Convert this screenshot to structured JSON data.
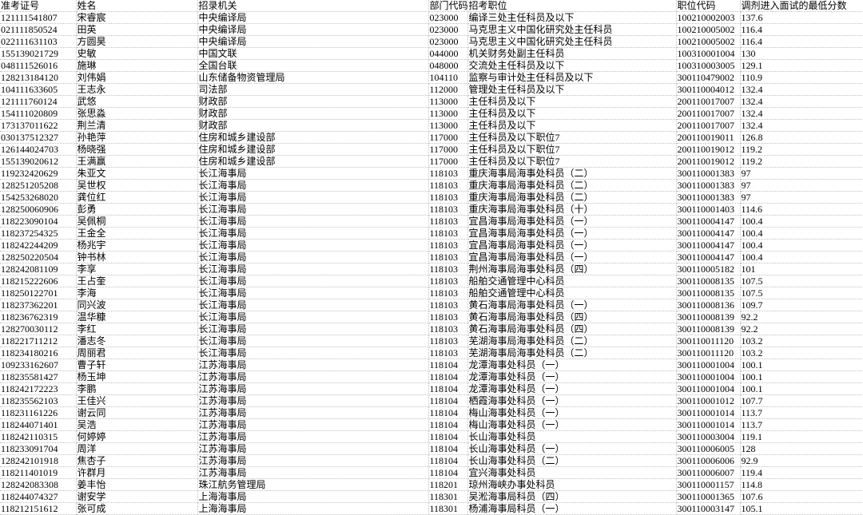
{
  "headers": [
    "准考证号",
    "姓名",
    "招录机关",
    "部门代码",
    "招考职位",
    "职位代码",
    "调剂进入面试的最低分数"
  ],
  "rows": [
    [
      "121111541807",
      "宋睿宸",
      "中央编译局",
      "023000",
      "编译三处主任科员及以下",
      "100210002003",
      "137.6"
    ],
    [
      "021111850524",
      "田英",
      "中央编译局",
      "023000",
      "马克思主义中国化研究处主任科员",
      "100210005002",
      "116.4"
    ],
    [
      "022111631103",
      "方圆昊",
      "中央编译局",
      "023000",
      "马克思主义中国化研究处主任科员",
      "100210005002",
      "116.4"
    ],
    [
      "155139021729",
      "史敏",
      "中国文联",
      "044000",
      "机关财务处副主任科员",
      "100310001004",
      "130"
    ],
    [
      "048111526016",
      "施琳",
      "全国台联",
      "048000",
      "交流处主任科员及以下",
      "100310003005",
      "129.1"
    ],
    [
      "128213184120",
      "刘伟娟",
      "山东储备物资管理局",
      "104110",
      "监察与审计处主任科员及以下",
      "300110479002",
      "110.9"
    ],
    [
      "104111633605",
      "王志永",
      "司法部",
      "112000",
      "管理处主任科员及以下",
      "300110004012",
      "132.4"
    ],
    [
      "121111760124",
      "武悠",
      "财政部",
      "113000",
      "主任科员及以下",
      "200110017007",
      "132.4"
    ],
    [
      "154111020809",
      "张思淼",
      "财政部",
      "113000",
      "主任科员及以下",
      "200110017007",
      "132.4"
    ],
    [
      "173137011622",
      "荆兰清",
      "财政部",
      "113000",
      "主任科员及以下",
      "200110017007",
      "132.4"
    ],
    [
      "030137512327",
      "孙艳萍",
      "住房和城乡建设部",
      "117000",
      "主任科员及以下职位7",
      "200110019011",
      "126.8"
    ],
    [
      "126144024703",
      "杨晓强",
      "住房和城乡建设部",
      "117000",
      "主任科员及以下职位7",
      "200110019012",
      "119.2"
    ],
    [
      "155139020612",
      "王满赢",
      "住房和城乡建设部",
      "117000",
      "主任科员及以下职位7",
      "200110019012",
      "119.2"
    ],
    [
      "119232420629",
      "朱亚文",
      "长江海事局",
      "118103",
      "重庆海事局海事处科员（二）",
      "300110001383",
      "97"
    ],
    [
      "128251205208",
      "吴世权",
      "长江海事局",
      "118103",
      "重庆海事局海事处科员（二）",
      "300110001383",
      "97"
    ],
    [
      "154253268020",
      "龚位红",
      "长江海事局",
      "118103",
      "重庆海事局海事处科员（二）",
      "300110001383",
      "97"
    ],
    [
      "128250060906",
      "彭勇",
      "长江海事局",
      "118103",
      "重庆海事局海事处科员（十）",
      "300110001403",
      "114.6"
    ],
    [
      "118223090104",
      "吴佩桐",
      "长江海事局",
      "118103",
      "宜昌海事局海事处科员（一）",
      "300110004147",
      "100.4"
    ],
    [
      "118237254325",
      "王金全",
      "长江海事局",
      "118103",
      "宜昌海事局海事处科员（一）",
      "300110004147",
      "100.4"
    ],
    [
      "118242244209",
      "杨兆宇",
      "长江海事局",
      "118103",
      "宜昌海事局海事处科员（一）",
      "300110004147",
      "100.4"
    ],
    [
      "128250220504",
      "钟书林",
      "长江海事局",
      "118103",
      "宜昌海事局海事处科员（一）",
      "300110004147",
      "100.4"
    ],
    [
      "128242081109",
      "李享",
      "长江海事局",
      "118103",
      "荆州海事局海事处科员（四）",
      "300110005182",
      "101"
    ],
    [
      "118215222606",
      "王占奎",
      "长江海事局",
      "118103",
      "船舶交通管理中心科员",
      "300110008135",
      "107.5"
    ],
    [
      "118250122701",
      "李海",
      "长江海事局",
      "118103",
      "船舶交通管理中心科员",
      "300110008135",
      "107.5"
    ],
    [
      "118237362201",
      "同兴波",
      "长江海事局",
      "118103",
      "黄石海事局海事处科员（一）",
      "300110008136",
      "109.7"
    ],
    [
      "118236762319",
      "温华糠",
      "长江海事局",
      "118103",
      "黄石海事局海事处科员（四）",
      "300110008139",
      "92.2"
    ],
    [
      "128270030112",
      "李红",
      "长江海事局",
      "118103",
      "黄石海事局海事处科员（四）",
      "300110008139",
      "92.2"
    ],
    [
      "118221711212",
      "潘志冬",
      "长江海事局",
      "118103",
      "芜湖海事局海事处科员（二）",
      "300110011120",
      "103.2"
    ],
    [
      "118234180216",
      "周丽君",
      "长江海事局",
      "118103",
      "芜湖海事局海事处科员（二）",
      "300110011120",
      "103.2"
    ],
    [
      "109233162607",
      "曹子轩",
      "江苏海事局",
      "118104",
      "龙潭海事处科员（一）",
      "300110001004",
      "100.1"
    ],
    [
      "118235581427",
      "杨玉坤",
      "江苏海事局",
      "118104",
      "龙潭海事处科员（一）",
      "300110001004",
      "100.1"
    ],
    [
      "118242172223",
      "李鹏",
      "江苏海事局",
      "118104",
      "龙潭海事处科员（一）",
      "300110001004",
      "100.1"
    ],
    [
      "118235562103",
      "王佳兴",
      "江苏海事局",
      "118104",
      "栖霞海事处科员（一）",
      "300110001012",
      "107.7"
    ],
    [
      "118231161226",
      "谢云同",
      "江苏海事局",
      "118104",
      "梅山海事处科员（一）",
      "300110001014",
      "113.7"
    ],
    [
      "118244071401",
      "吴浩",
      "江苏海事局",
      "118104",
      "梅山海事处科员（一）",
      "300110001014",
      "113.7"
    ],
    [
      "118242110315",
      "何婷婷",
      "江苏海事局",
      "118104",
      "长山海事处科员",
      "300110003004",
      "119.1"
    ],
    [
      "118233091704",
      "周洋",
      "江苏海事局",
      "118104",
      "长山海事处科员（一）",
      "300110006005",
      "128"
    ],
    [
      "128242101918",
      "焦杏子",
      "江苏海事局",
      "118104",
      "长山海事处科员（二）",
      "300110006006",
      "92.9"
    ],
    [
      "118211401019",
      "许群月",
      "江苏海事局",
      "118104",
      "宜兴海事处科员",
      "300110006007",
      "119.4"
    ],
    [
      "128242083308",
      "姜丰怡",
      "珠江航务管理局",
      "118201",
      "琼州海峡办事处科员",
      "300110001157",
      "114.8"
    ],
    [
      "118244074327",
      "谢安学",
      "上海海事局",
      "118301",
      "吴淞海事局科员（四）",
      "300110001365",
      "107.6"
    ],
    [
      "118212151612",
      "张可成",
      "上海海事局",
      "118301",
      "杨浦海事局科员（一）",
      "300110003147",
      "105.1"
    ]
  ]
}
